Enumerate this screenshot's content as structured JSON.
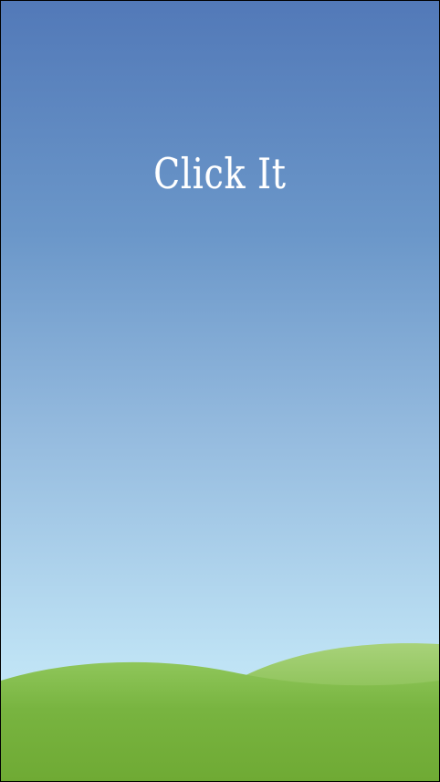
{
  "main": {
    "title": "Click It"
  },
  "colors": {
    "sky_top": "#5279b8",
    "sky_bottom": "#c8ebf8",
    "hill_light": "#a8d27a",
    "hill_dark": "#72b23a"
  }
}
